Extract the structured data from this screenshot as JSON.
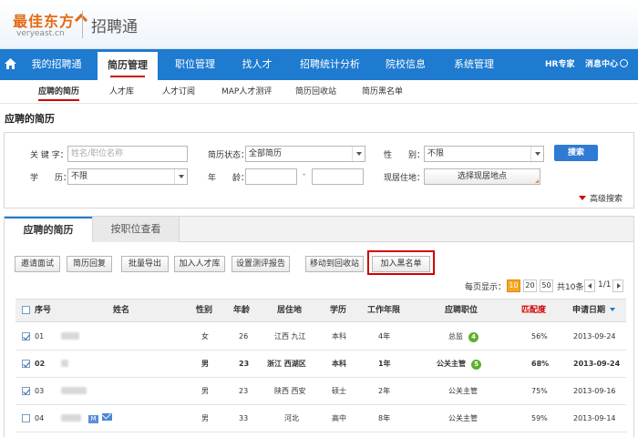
{
  "brand": {
    "name_cn": "最佳东方",
    "domain": "veryeast.cn",
    "product": "招聘通",
    "orange": "#e56a12"
  },
  "main_nav": {
    "home_icon": "home-icon",
    "items": [
      "我的招聘通",
      "简历管理",
      "职位管理",
      "找人才",
      "招聘统计分析",
      "院校信息",
      "系统管理"
    ],
    "active": "简历管理",
    "hr_expert": "HR专家",
    "messages": "消息中心",
    "bg_color": "#1e7bd0"
  },
  "sub_nav": {
    "items": [
      "应聘的简历",
      "人才库",
      "人才订阅",
      "MAP人才测评",
      "简历回收站",
      "简历黑名单"
    ],
    "active": "应聘的简历"
  },
  "page_title": "应聘的简历",
  "search": {
    "keyword_label": "关 键 字：",
    "keyword_placeholder": "姓名/职位名称",
    "status_label": "简历状态：",
    "status_value": "全部简历",
    "gender_label": "性　　别：",
    "gender_value": "不限",
    "search_button": "搜索",
    "education_label": "学　　历：",
    "education_value": "不限",
    "age_label": "年　　龄：",
    "age_sep": "-",
    "location_label": "现居住地：",
    "location_button": "选择现居地点",
    "advanced": "高级搜索"
  },
  "tabs": {
    "active": "应聘的简历",
    "other": "按职位查看"
  },
  "actions": [
    "邀请面试",
    "简历回复",
    "批量导出",
    "加入人才库",
    "设置测评报告",
    "移动到回收站",
    "加入黑名单"
  ],
  "pager": {
    "per_page_label": "每页显示：",
    "sizes": [
      "10",
      "20",
      "50"
    ],
    "selected": "10",
    "total": "共10条",
    "page": "1/1"
  },
  "table": {
    "headers": [
      "序号",
      "姓名",
      "性别",
      "年龄",
      "居住地",
      "学历",
      "工作年限",
      "应聘职位",
      "匹配度",
      "申请日期"
    ],
    "rows": [
      {
        "no": "01",
        "gender": "女",
        "age": "26",
        "location": "江西 九江",
        "edu": "本科",
        "years": "4年",
        "position": "总监",
        "badge": "4",
        "match": "56%",
        "date": "2013-09-24",
        "checked": true,
        "bold": false,
        "icons": false
      },
      {
        "no": "02",
        "gender": "男",
        "age": "23",
        "location": "浙江 西湖区",
        "edu": "本科",
        "years": "1年",
        "position": "公关主管",
        "badge": "5",
        "match": "68%",
        "date": "2013-09-24",
        "checked": true,
        "bold": true,
        "icons": false
      },
      {
        "no": "03",
        "gender": "男",
        "age": "23",
        "location": "陕西 西安",
        "edu": "硕士",
        "years": "2年",
        "position": "公关主管",
        "badge": "",
        "match": "75%",
        "date": "2013-09-16",
        "checked": true,
        "bold": false,
        "icons": false
      },
      {
        "no": "04",
        "gender": "男",
        "age": "33",
        "location": "河北",
        "edu": "高中",
        "years": "8年",
        "position": "公关主管",
        "badge": "",
        "match": "59%",
        "date": "2013-09-14",
        "checked": false,
        "bold": false,
        "icons": true
      }
    ]
  },
  "colors": {
    "accent": "#1e7bd0",
    "red": "#d20000",
    "page_selected": "#f5a623",
    "badge_green": "#5fb02e"
  }
}
